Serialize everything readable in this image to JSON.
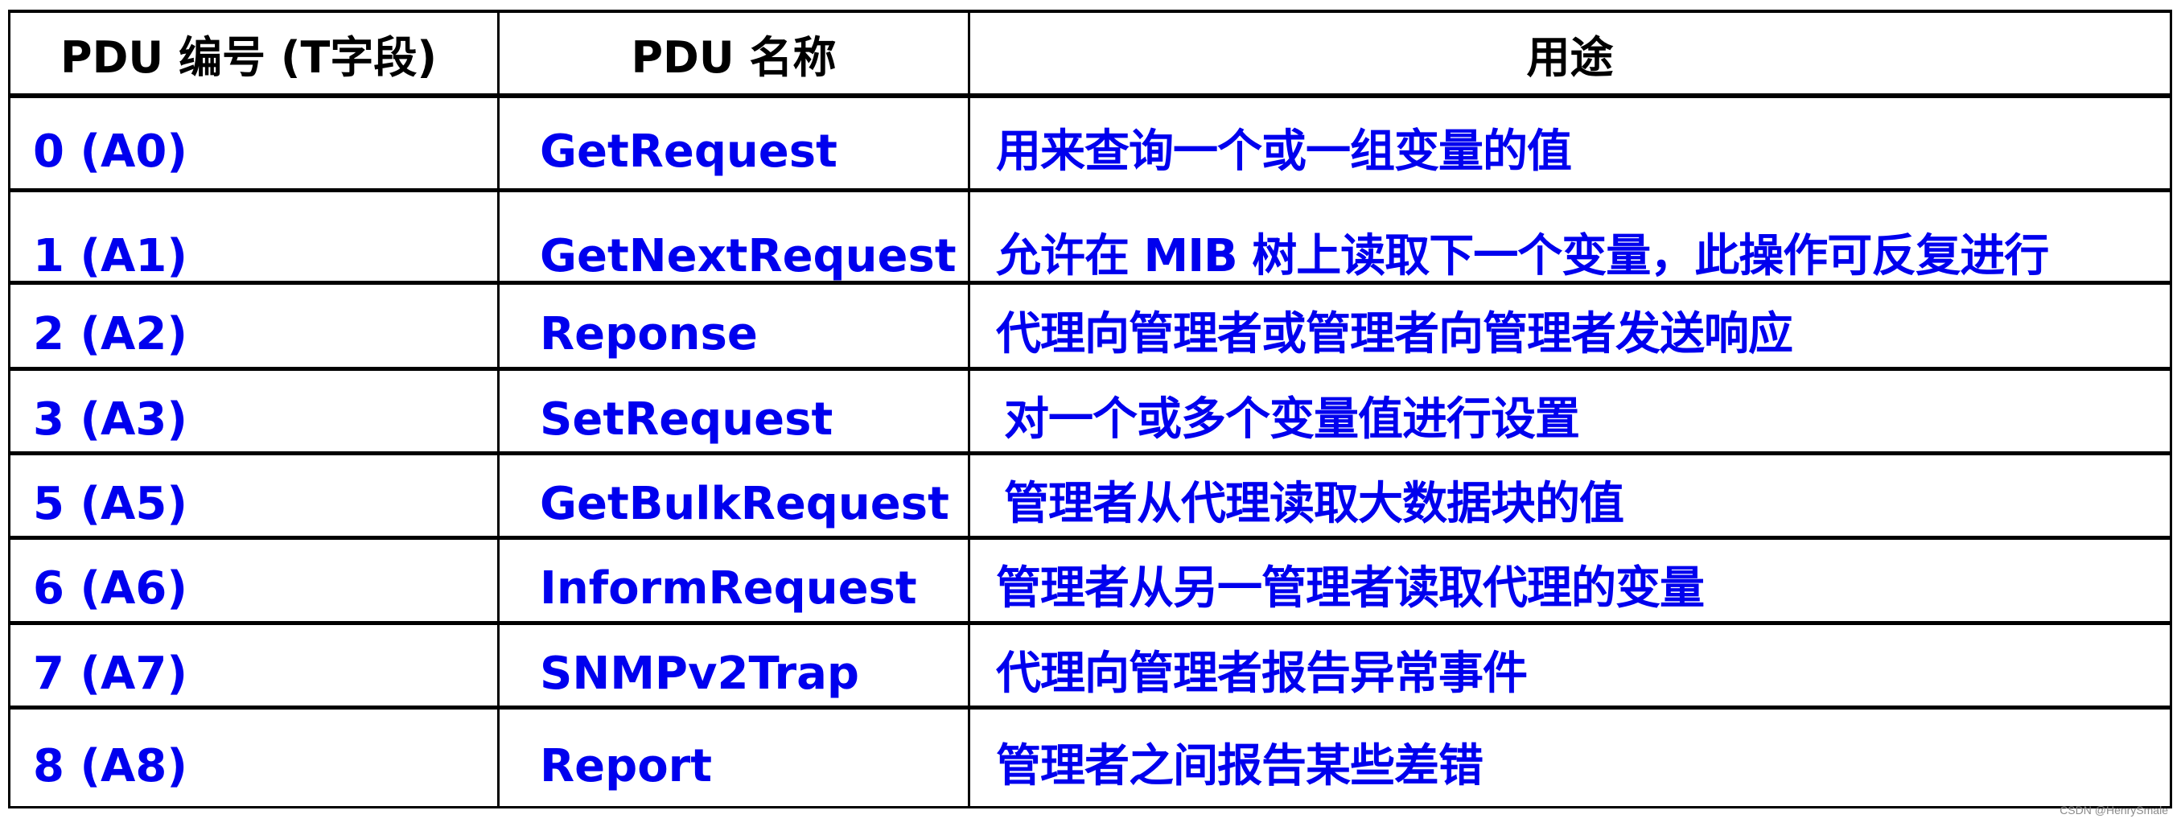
{
  "table": {
    "headers": [
      "PDU 编号 (T字段)",
      "PDU 名称",
      "用途"
    ],
    "rows": [
      {
        "code": "0  (A0)",
        "name": "GetRequest",
        "purpose": "用来查询一个或一组变量的值"
      },
      {
        "code": "1  (A1)",
        "name": "GetNextRequest",
        "purpose": "允许在 MIB 树上读取下一个变量，此操作可反复进行"
      },
      {
        "code": "2  (A2)",
        "name": "Reponse",
        "purpose": "代理向管理者或管理者向管理者发送响应"
      },
      {
        "code": "3  (A3)",
        "name": "SetRequest",
        "purpose": "对一个或多个变量值进行设置"
      },
      {
        "code": "5  (A5)",
        "name": "GetBulkRequest",
        "purpose": "管理者从代理读取大数据块的值"
      },
      {
        "code": "6  (A6)",
        "name": "InformRequest",
        "purpose": "管理者从另一管理者读取代理的变量"
      },
      {
        "code": "7  (A7)",
        "name": "SNMPv2Trap",
        "purpose": "代理向管理者报告异常事件"
      },
      {
        "code": "8  (A8)",
        "name": "Report",
        "purpose": "管理者之间报告某些差错"
      }
    ]
  },
  "colors": {
    "header_text": "#000000",
    "body_text": "#0000ee",
    "border": "#000000",
    "background": "#ffffff"
  },
  "watermark": "CSDN @HenrySmale"
}
